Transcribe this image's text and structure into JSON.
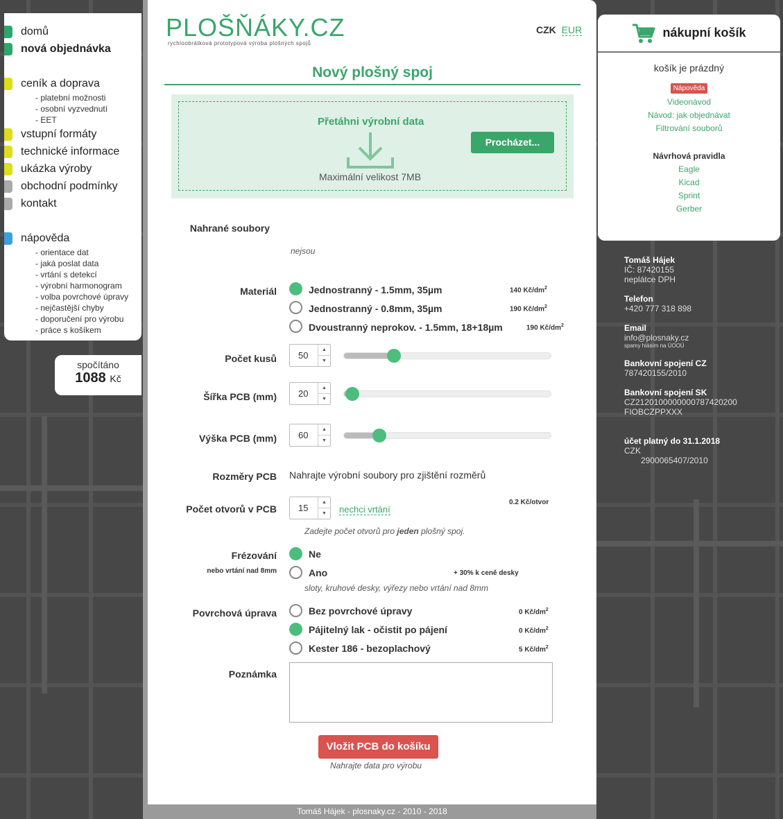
{
  "nav": {
    "primary": [
      {
        "label": "domů",
        "color": "#2aa86a"
      },
      {
        "label": "nová objednávka",
        "color": "#2aa86a"
      }
    ],
    "pricing": {
      "label": "ceník a doprava",
      "color": "#dede1c"
    },
    "pricing_sub": [
      "- platební možnosti",
      "- osobní vyzvednutí",
      "- EET"
    ],
    "info": [
      {
        "label": "vstupní formáty",
        "color": "#dede1c"
      },
      {
        "label": "technické informace",
        "color": "#dede1c"
      },
      {
        "label": "ukázka výroby",
        "color": "#dede1c"
      },
      {
        "label": "obchodní podmínky",
        "color": "#aaaaaa"
      },
      {
        "label": "kontakt",
        "color": "#aaaaaa"
      }
    ],
    "help": {
      "label": "nápověda",
      "color": "#3aa0d8"
    },
    "help_sub": [
      "- orientace dat",
      "- jaká poslat data",
      "- vrtání s detekcí",
      "- výrobní harmonogram",
      "- volba povrchové úpravy",
      "- nejčastější chyby",
      "- doporučení pro výrobu",
      "- práce s košíkem"
    ]
  },
  "total": {
    "label": "spočítáno",
    "value": "1088",
    "unit": "Kč"
  },
  "header": {
    "logo": "PLOŠŇÁKY.CZ",
    "logo_sub": "rychloobrátková prototypová výroba plošných spojů",
    "currency_active": "CZK",
    "currency_other": "EUR"
  },
  "form": {
    "title": "Nový plošný spoj",
    "drop_title": "Přetáhni výrobní data",
    "drop_max": "Maximální velikost 7MB",
    "browse": "Procházet...",
    "uploaded_label": "Nahrané soubory",
    "uploaded_value": "nejsou",
    "material_label": "Materiál",
    "materials": [
      {
        "label": "Jednostranný - 1.5mm, 35µm",
        "price": "140 Kč/dm",
        "selected": true
      },
      {
        "label": "Jednostranný - 0.8mm, 35µm",
        "price": "190 Kč/dm",
        "selected": false
      },
      {
        "label": "Dvoustranný neprokov. - 1.5mm, 18+18µm",
        "price": "190 Kč/dm",
        "selected": false
      }
    ],
    "sup2": "2",
    "count_label": "Počet kusů",
    "count_value": "50",
    "count_fill": 0.24,
    "width_label": "Šířka PCB (mm)",
    "width_value": "20",
    "width_fill": 0.04,
    "height_label": "Výška PCB (mm)",
    "height_value": "60",
    "height_fill": 0.17,
    "dims_label": "Rozměry PCB",
    "dims_value": "Nahrajte výrobní soubory pro zjištění rozměrů",
    "holes_label": "Počet otvorů v PCB",
    "holes_value": "15",
    "holes_link": "nechci vrtání",
    "holes_price": "0.2 Kč/otvor",
    "holes_hint_pre": "Zadejte počet otvorů pro ",
    "holes_hint_bold": "jeden",
    "holes_hint_post": " plošný spoj.",
    "milling_label": "Frézování",
    "milling_sub": "nebo vrtání nad 8mm",
    "milling_options": [
      {
        "label": "Ne",
        "selected": true
      },
      {
        "label": "Ano",
        "selected": false
      }
    ],
    "milling_price": "+ 30% k ceně desky",
    "milling_hint": "sloty, kruhové desky, výřezy nebo vrtání nad 8mm",
    "surface_label": "Povrchová úprava",
    "surfaces": [
      {
        "label": "Bez povrchové úpravy",
        "price": "0 Kč/dm",
        "selected": false
      },
      {
        "label": "Pájitelný lak - očistit po pájení",
        "price": "0 Kč/dm",
        "selected": true
      },
      {
        "label": "Kester 186 - bezoplachový",
        "price": "5 Kč/dm",
        "selected": false
      }
    ],
    "note_label": "Poznámka",
    "submit": "Vložit PCB do košíku",
    "submit_hint": "Nahrajte data pro výrobu"
  },
  "footer": "Tomáš Hájek - plosnaky.cz - 2010 - 2018",
  "cart": {
    "title": "nákupní košík",
    "empty": "košík je prázdný",
    "badge": "Nápověda",
    "links": [
      "Videonávod",
      "Návod: jak objednávat",
      "Filtrování souborů"
    ],
    "rules_title": "Návrhová pravidla",
    "rules": [
      "Eagle",
      "Kicad",
      "Sprint",
      "Gerber"
    ]
  },
  "contact": {
    "name": "Tomáš Hájek",
    "ic": "IČ: 87420155",
    "dph": "neplátce DPH",
    "phone_h": "Telefon",
    "phone": "+420 777 318 898",
    "email_h": "Email",
    "email": "info@plosnaky.cz",
    "email_note": "spamy hlásím na ÚOOÚ",
    "bank_cz_h": "Bankovní spojení CZ",
    "bank_cz": "787420155/2010",
    "bank_sk_h": "Bankovní spojení SK",
    "bank_sk1": "CZ2120100000000787420200",
    "bank_sk2": "FIOBCZPPXXX",
    "acct_h": "účet platný do 31.1.2018",
    "acct_cur": "CZK",
    "acct_num": "2900065407/2010"
  }
}
